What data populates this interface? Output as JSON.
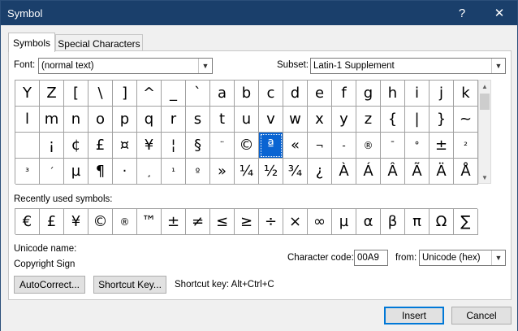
{
  "window": {
    "title": "Symbol",
    "help_label": "?",
    "close_label": "✕"
  },
  "tabs": [
    {
      "label": "Symbols",
      "active": true
    },
    {
      "label": "Special Characters",
      "active": false
    }
  ],
  "font": {
    "label": "Font:",
    "value": "(normal text)"
  },
  "subset": {
    "label": "Subset:",
    "value": "Latin-1 Supplement"
  },
  "symbols": [
    "Y",
    "Z",
    "[",
    "\\",
    "]",
    "^",
    "_",
    "`",
    "a",
    "b",
    "c",
    "d",
    "e",
    "f",
    "g",
    "h",
    "i",
    "j",
    "k",
    "l",
    "m",
    "n",
    "o",
    "p",
    "q",
    "r",
    "s",
    "t",
    "u",
    "v",
    "w",
    "x",
    "y",
    "z",
    "{",
    "|",
    "}",
    "~",
    " ",
    "¡",
    "¢",
    "£",
    "¤",
    "¥",
    "¦",
    "§",
    "¨",
    "©",
    "ª",
    "«",
    "¬",
    "-",
    "®",
    "¯",
    "°",
    "±",
    "²",
    "³",
    "´",
    "µ",
    "¶",
    "·",
    "¸",
    "¹",
    "º",
    "»",
    "¼",
    "½",
    "¾",
    "¿",
    "À",
    "Á",
    "Â",
    "Ã",
    "Ä",
    "Å"
  ],
  "selected_symbol_index": 48,
  "recently_used": {
    "label": "Recently used symbols:",
    "items": [
      "€",
      "£",
      "¥",
      "©",
      "®",
      "™",
      "±",
      "≠",
      "≤",
      "≥",
      "÷",
      "×",
      "∞",
      "µ",
      "α",
      "β",
      "π",
      "Ω",
      "∑"
    ]
  },
  "unicode_name": {
    "label": "Unicode name:",
    "value": "Copyright Sign"
  },
  "character_code": {
    "label": "Character code:",
    "value": "00A9"
  },
  "from": {
    "label": "from:",
    "value": "Unicode (hex)"
  },
  "buttons": {
    "autocorrect": "AutoCorrect...",
    "shortcut_key": "Shortcut Key...",
    "insert": "Insert",
    "cancel": "Cancel"
  },
  "shortcut_key_text": "Shortcut key: Alt+Ctrl+C",
  "icons": {
    "dropdown": "chevron-down-icon",
    "scroll_up": "triangle-up-icon",
    "scroll_down": "triangle-down-icon"
  }
}
